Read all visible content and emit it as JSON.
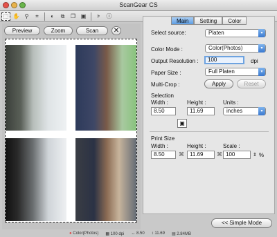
{
  "window": {
    "title": "ScanGear CS"
  },
  "toolbar": {
    "icons": [
      "marquee-icon",
      "hand-icon",
      "zoom-icon",
      "crop-icon",
      "auto-crop-icon",
      "multi-crop-icon",
      "copy-icon",
      "select-all-icon",
      "layout-icon",
      "info-icon"
    ]
  },
  "actions": {
    "preview": "Preview",
    "zoom": "Zoom",
    "scan": "Scan",
    "close": "✕"
  },
  "tabs": [
    {
      "label": "Main"
    },
    {
      "label": "Setting"
    },
    {
      "label": "Color"
    }
  ],
  "form": {
    "select_source_label": "Select source:",
    "select_source_value": "Platen",
    "color_mode_label": "Color Mode :",
    "color_mode_value": "Color(Photos)",
    "output_resolution_label": "Output Resolution :",
    "output_resolution_value": "100",
    "output_resolution_unit": "dpi",
    "paper_size_label": "Paper Size :",
    "paper_size_value": "Full Platen",
    "multi_crop_label": "Multi-Crop :",
    "apply": "Apply",
    "reset": "Reset",
    "selection_label": "Selection",
    "sel_width_label": "Width :",
    "sel_height_label": "Height :",
    "sel_units_label": "Units :",
    "sel_width_value": "8.50",
    "sel_height_value": "11.69",
    "sel_units_value": "inches",
    "print_size_label": "Print Size",
    "print_width_label": "Width :",
    "print_height_label": "Height :",
    "print_scale_label": "Scale :",
    "print_width_value": "8.50",
    "print_height_value": "11.69",
    "print_scale_value": "100",
    "print_scale_unit": "%",
    "simple_mode": "<< Simple Mode"
  },
  "status": {
    "color_mode": "Color(Photos)",
    "resolution": "100 dpi",
    "width": "8.50",
    "height": "11.69",
    "size": "2.84MB"
  },
  "colors": {
    "accent": "#5d9ee5",
    "panel": "#e6e6e6",
    "window": "#c9c9c9"
  }
}
